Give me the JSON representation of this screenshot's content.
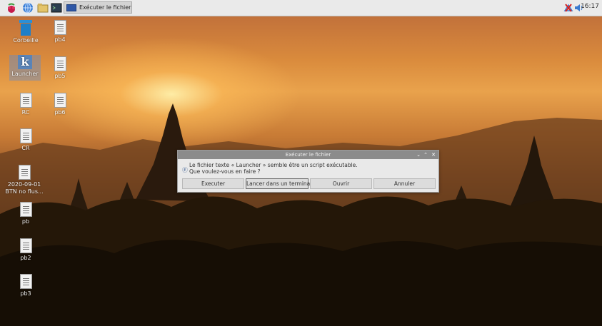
{
  "taskbar": {
    "active_task": "Exécuter le fichier",
    "clock": "16:17"
  },
  "desktop": {
    "icons": [
      {
        "label": "Corbeille"
      },
      {
        "label": "pb4"
      },
      {
        "label": "Launcher"
      },
      {
        "label": "pb5"
      },
      {
        "label": "RC"
      },
      {
        "label": "pb6"
      },
      {
        "label": "CR"
      },
      {
        "label": "2020-09-01 BTN no flus..."
      },
      {
        "label": "pb"
      },
      {
        "label": "pb2"
      },
      {
        "label": "pb3"
      }
    ]
  },
  "dialog": {
    "title": "Exécuter le fichier",
    "message_line1": "Le fichier texte « Launcher » semble être un script exécutable.",
    "message_line2": "Que voulez-vous en faire ?",
    "buttons": {
      "execute": "Executer",
      "terminal": "Lancer dans un terminal",
      "open": "Ouvrir",
      "cancel": "Annuler"
    }
  }
}
